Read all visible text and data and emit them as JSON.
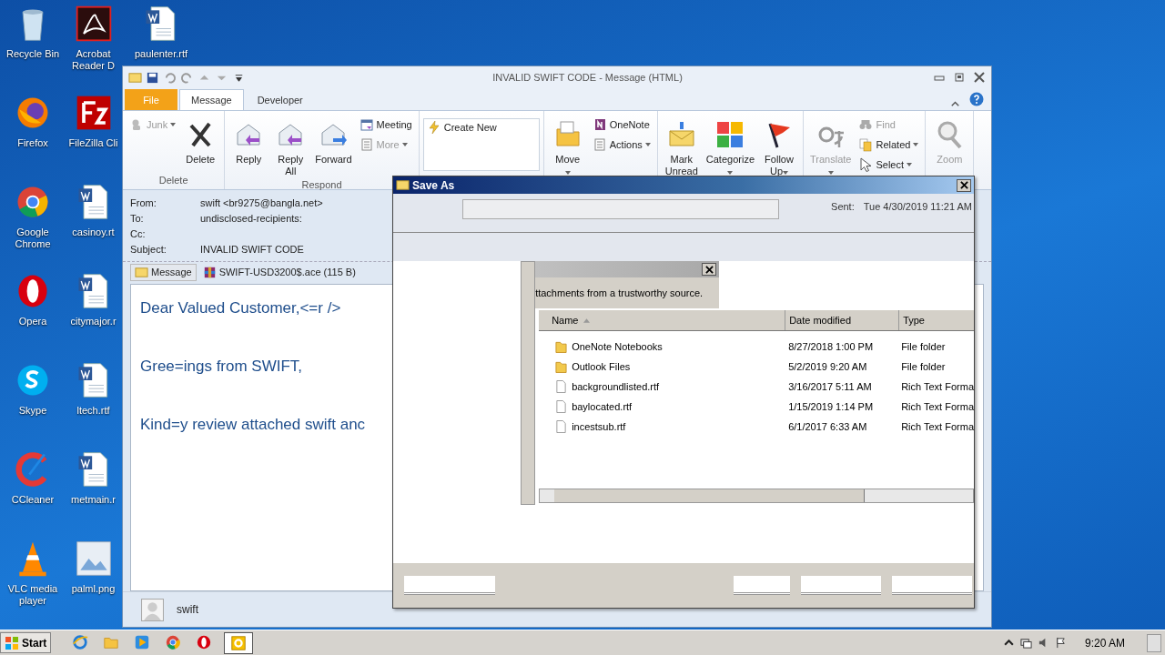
{
  "desktop_icons": [
    {
      "label": "Recycle Bin",
      "kind": "recycle"
    },
    {
      "label": "Firefox",
      "kind": "firefox"
    },
    {
      "label": "Google Chrome",
      "kind": "chrome"
    },
    {
      "label": "Opera",
      "kind": "opera"
    },
    {
      "label": "Skype",
      "kind": "skype"
    },
    {
      "label": "CCleaner",
      "kind": "ccleaner"
    },
    {
      "label": "VLC media player",
      "kind": "vlc"
    },
    {
      "label": "Acrobat Reader D",
      "kind": "acrobat"
    },
    {
      "label": "FileZilla Cli",
      "kind": "filezilla"
    },
    {
      "label": "casinoy.rt",
      "kind": "word"
    },
    {
      "label": "citymajor.r",
      "kind": "word"
    },
    {
      "label": "ltech.rtf",
      "kind": "word"
    },
    {
      "label": "metmain.r",
      "kind": "word"
    },
    {
      "label": "palml.png",
      "kind": "image"
    },
    {
      "label": "paulenter.rtf",
      "kind": "word"
    }
  ],
  "outlook": {
    "title": "INVALID SWIFT CODE - Message (HTML)",
    "tabs": [
      {
        "label": "File",
        "kind": "file",
        "selected": false
      },
      {
        "label": "Message",
        "kind": "tab",
        "selected": true
      },
      {
        "label": "Developer",
        "kind": "tab",
        "selected": false
      }
    ],
    "groups": [
      {
        "label": "Delete",
        "columns": [
          {
            "kind": "stack",
            "items": [
              {
                "label": "Junk",
                "kind": "junk",
                "disabled": true,
                "dropdown": true
              }
            ]
          },
          {
            "kind": "large",
            "items": [
              {
                "label": "Delete",
                "kind": "delete",
                "disabled": false,
                "dropdown": false
              }
            ]
          }
        ]
      },
      {
        "label": "Respond",
        "columns": [
          {
            "kind": "large",
            "items": [
              {
                "label": "Reply",
                "kind": "reply",
                "disabled": false,
                "dropdown": false
              }
            ]
          },
          {
            "kind": "large",
            "items": [
              {
                "label": "Reply All",
                "kind": "replyall",
                "disabled": false,
                "dropdown": false
              }
            ]
          },
          {
            "kind": "large",
            "items": [
              {
                "label": "Forward",
                "kind": "forward",
                "disabled": false,
                "dropdown": false
              }
            ]
          },
          {
            "kind": "stack",
            "items": [
              {
                "label": "Meeting",
                "kind": "meeting",
                "disabled": false,
                "dropdown": false
              },
              {
                "label": "More",
                "kind": "more",
                "disabled": true,
                "dropdown": true
              }
            ]
          }
        ]
      },
      {
        "columns": [
          {
            "kind": "gallery",
            "items": [
              {
                "label": "Create New",
                "kind": "quickstep",
                "disabled": false,
                "dropdown": false
              }
            ]
          }
        ]
      },
      {
        "columns": [
          {
            "kind": "large",
            "items": [
              {
                "label": "Move",
                "kind": "move",
                "disabled": false,
                "dropdown": true
              }
            ]
          },
          {
            "kind": "stack",
            "items": [
              {
                "label": "OneNote",
                "kind": "onenote",
                "disabled": false,
                "dropdown": false
              },
              {
                "label": "Actions",
                "kind": "actions",
                "disabled": false,
                "dropdown": true
              }
            ]
          }
        ]
      },
      {
        "columns": [
          {
            "kind": "large",
            "items": [
              {
                "label": "Mark Unread",
                "kind": "unread",
                "disabled": false,
                "dropdown": false
              }
            ]
          },
          {
            "kind": "large",
            "items": [
              {
                "label": "Categorize",
                "kind": "categorize",
                "disabled": false,
                "dropdown": true
              }
            ]
          },
          {
            "kind": "large",
            "items": [
              {
                "label": "Follow Up",
                "kind": "flag",
                "disabled": false,
                "dropdown": true
              }
            ]
          }
        ]
      },
      {
        "columns": [
          {
            "kind": "large",
            "items": [
              {
                "label": "Translate",
                "kind": "translate",
                "disabled": true,
                "dropdown": true
              }
            ]
          },
          {
            "kind": "stack",
            "items": [
              {
                "label": "Find",
                "kind": "find",
                "disabled": true,
                "dropdown": false
              },
              {
                "label": "Related",
                "kind": "related",
                "disabled": false,
                "dropdown": true
              },
              {
                "label": "Select",
                "kind": "select",
                "disabled": false,
                "dropdown": true
              }
            ]
          }
        ]
      },
      {
        "columns": [
          {
            "kind": "large",
            "items": [
              {
                "label": "Zoom",
                "kind": "zoom",
                "disabled": true,
                "dropdown": false
              }
            ]
          }
        ]
      }
    ],
    "fields": [
      {
        "label": "From:",
        "value": "swift <br9275@bangla.net>"
      },
      {
        "label": "To:",
        "value": "undisclosed-recipients:"
      },
      {
        "label": "Cc:"
      },
      {
        "label": "Subject:",
        "value": "INVALID SWIFT CODE"
      }
    ],
    "attachments": [
      {
        "label": "Message",
        "kind": "message",
        "selected": true
      },
      {
        "label": "SWIFT-USD3200$.ace (115 B)",
        "kind": "archive",
        "selected": false
      }
    ],
    "body": [
      "Dear Valued Customer,<=r />",
      "Gree=ings from SWIFT,",
      "Kind=y review attached swift anc"
    ],
    "contact": "swift"
  },
  "save_as": {
    "title": "Save As",
    "sent_label": "Sent:",
    "sent_value": "Tue 4/30/2019 11:21 AM",
    "notice": "ttachments from a trustworthy source.",
    "columns": [
      {
        "label": "Name",
        "sorted": true
      },
      {
        "label": "Date modified",
        "sorted": false
      },
      {
        "label": "Type",
        "sorted": false
      }
    ],
    "rows": [
      {
        "name": "OneNote Notebooks",
        "kind": "folder",
        "date": "8/27/2018 1:00 PM",
        "type": "File folder"
      },
      {
        "name": "Outlook Files",
        "kind": "folder",
        "date": "5/2/2019 9:20 AM",
        "type": "File folder"
      },
      {
        "name": "backgroundlisted.rtf",
        "kind": "file",
        "date": "3/16/2017 5:11 AM",
        "type": "Rich Text Forma"
      },
      {
        "name": "baylocated.rtf",
        "kind": "file",
        "date": "1/15/2019 1:14 PM",
        "type": "Rich Text Forma"
      },
      {
        "name": "incestsub.rtf",
        "kind": "file",
        "date": "6/1/2017 6:33 AM",
        "type": "Rich Text Forma"
      }
    ]
  },
  "taskbar": {
    "start": "Start",
    "apps": [
      {
        "kind": "ie",
        "selected": false
      },
      {
        "kind": "explorer",
        "selected": false
      },
      {
        "kind": "media",
        "selected": false
      },
      {
        "kind": "chrome",
        "selected": false
      },
      {
        "kind": "opera",
        "selected": false
      },
      {
        "kind": "outlook",
        "selected": true
      }
    ],
    "clock": "9:20 AM"
  }
}
